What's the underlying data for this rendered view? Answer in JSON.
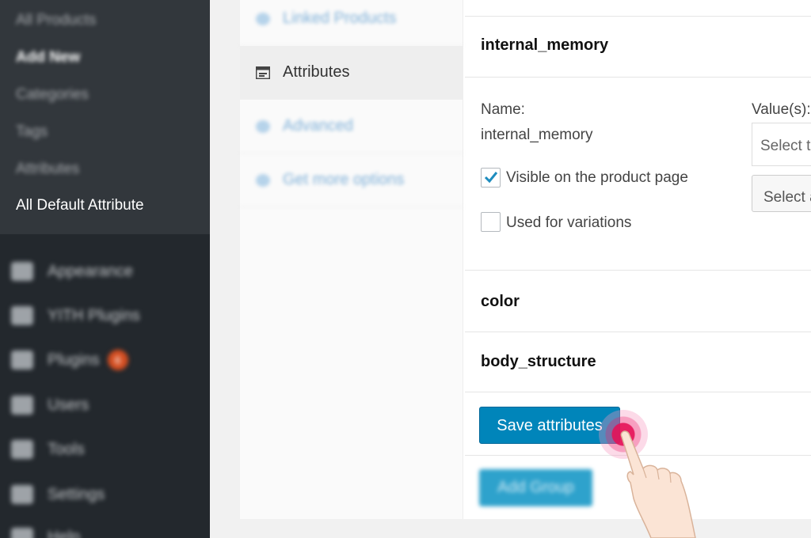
{
  "sidebar": {
    "submenu": [
      {
        "label": "All Products"
      },
      {
        "label": "Add New"
      },
      {
        "label": "Categories"
      },
      {
        "label": "Tags"
      },
      {
        "label": "Attributes"
      },
      {
        "label": "All Default Attribute"
      }
    ],
    "menu": [
      {
        "label": "Appearance",
        "icon": "paintbrush-icon"
      },
      {
        "label": "YITH Plugins",
        "icon": "yith-icon"
      },
      {
        "label": "Plugins",
        "icon": "plugin-icon",
        "badge": "6"
      },
      {
        "label": "Users",
        "icon": "users-icon"
      },
      {
        "label": "Tools",
        "icon": "wrench-icon"
      },
      {
        "label": "Settings",
        "icon": "settings-icon"
      },
      {
        "label": "Help",
        "icon": "help-icon"
      }
    ]
  },
  "tabs": [
    {
      "label": "Linked Products",
      "icon": "link-icon"
    },
    {
      "label": "Attributes",
      "icon": "attributes-icon"
    },
    {
      "label": "Advanced",
      "icon": "gear-icon"
    },
    {
      "label": "Get more options",
      "icon": "star-icon"
    }
  ],
  "attributes": {
    "expanded": {
      "title": "internal_memory",
      "name_label": "Name:",
      "name_value": "internal_memory",
      "values_label": "Value(s):",
      "select_placeholder": "Select terms",
      "select_all_button": "Select all",
      "visible_label": "Visible on the product page",
      "visible_checked": true,
      "variations_label": "Used for variations",
      "variations_checked": false
    },
    "collapsed": [
      {
        "title": "color"
      },
      {
        "title": "body_structure"
      }
    ]
  },
  "buttons": {
    "save": "Save attributes",
    "add_group": "Add Group"
  },
  "colors": {
    "primary": "#0085ba",
    "sidebar_bg": "#23282d",
    "submenu_bg": "#32373c",
    "click_indicator": "#e6145a"
  }
}
